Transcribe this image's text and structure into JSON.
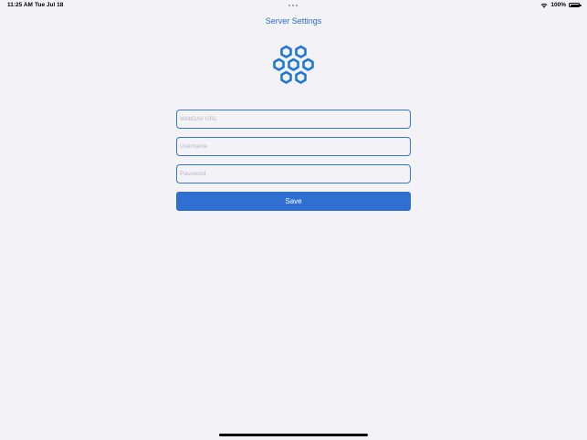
{
  "status_bar": {
    "time": "11:25 AM",
    "date": "Tue Jul 18",
    "battery": "100%",
    "icons": [
      "wifi-icon",
      "battery-icon"
    ]
  },
  "header": {
    "title": "Server Settings"
  },
  "logo": {
    "icon": "honeycomb-icon",
    "color": "#1f78d1"
  },
  "form": {
    "webdav_url": {
      "value": "",
      "placeholder": "WebDAV URL"
    },
    "username": {
      "value": "",
      "placeholder": "Username"
    },
    "password": {
      "value": "",
      "placeholder": "Password"
    },
    "save_label": "Save"
  },
  "colors": {
    "accent": "#2f6fd1",
    "background": "#f2f2f7",
    "title": "#2c6cc4"
  }
}
